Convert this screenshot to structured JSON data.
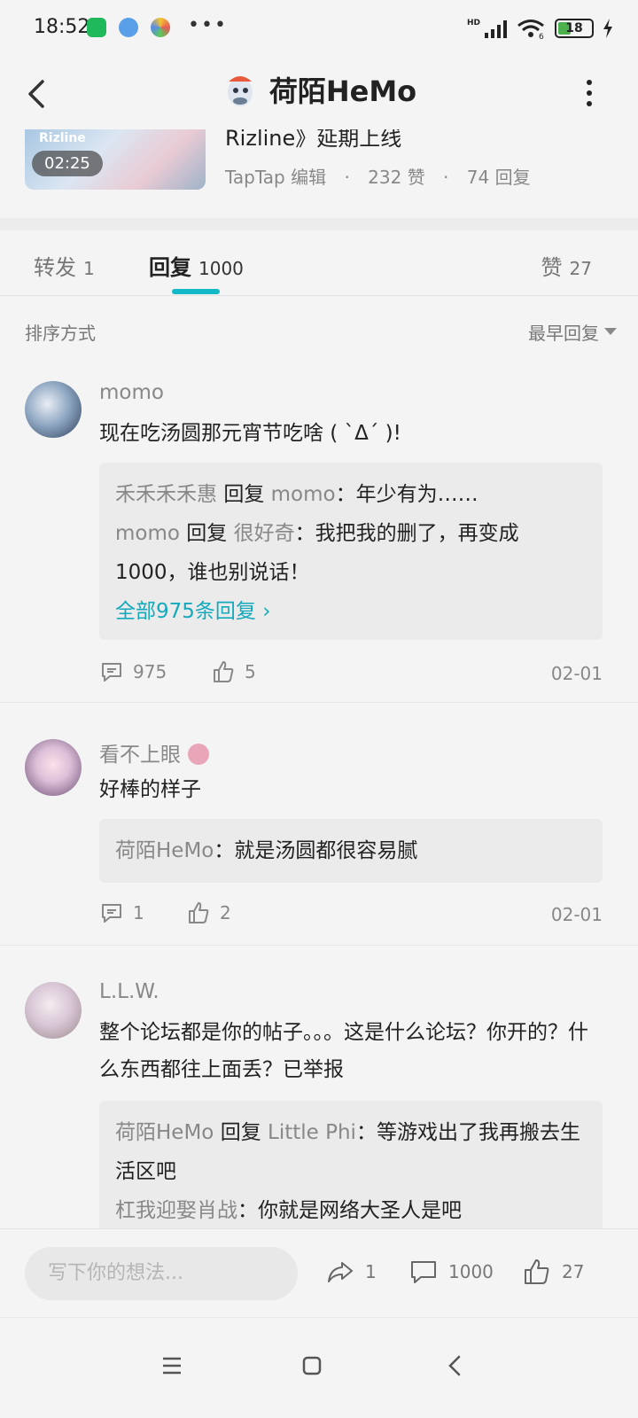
{
  "status_bar": {
    "time": "18:52",
    "battery": "18",
    "network": "HD",
    "wifi_label": "6"
  },
  "header": {
    "title": "荷陌HeMo"
  },
  "article": {
    "title": "Rizline》延期上线",
    "thumb_logo": "Rizline",
    "duration": "02:25",
    "source": "TapTap 编辑",
    "likes": "232 赞",
    "replies": "74 回复"
  },
  "tabs": [
    {
      "label": "转发",
      "count": "1"
    },
    {
      "label": "回复",
      "count": "1000"
    },
    {
      "label": "赞",
      "count": "27"
    }
  ],
  "sort": {
    "label": "排序方式",
    "value": "最早回复"
  },
  "comments": [
    {
      "user": "momo",
      "text": "现在吃汤圆那元宵节吃啥 ( `Δ´ )!",
      "replies": [
        {
          "from": "禾禾禾禾惠",
          "verb": "回复",
          "to": "momo",
          "text": "：年少有为……"
        },
        {
          "from": "momo",
          "verb": "回复",
          "to": "很好奇",
          "text": "：我把我的删了，再变成1000，谁也别说话！"
        }
      ],
      "more_link": "全部975条回复",
      "reply_count": "975",
      "like_count": "5",
      "date": "02-01"
    },
    {
      "user": "看不上眼",
      "text": "好棒的样子",
      "replies": [
        {
          "from": "荷陌HeMo",
          "text": "：就是汤圆都很容易腻"
        }
      ],
      "reply_count": "1",
      "like_count": "2",
      "date": "02-01"
    },
    {
      "user": "L.L.W.",
      "text": "整个论坛都是你的帖子。。。这是什么论坛？你开的？什么东西都往上面丢？已举报",
      "replies": [
        {
          "from": "荷陌HeMo",
          "verb": "回复",
          "to": "Little Phi",
          "text": "：等游戏出了我再搬去生活区吧"
        },
        {
          "from": "杠我迎娶肖战",
          "text": "：你就是网络大圣人是吧"
        }
      ]
    }
  ],
  "compose": {
    "placeholder": "写下你的想法...",
    "share_count": "1",
    "comment_count": "1000",
    "like_count": "27"
  },
  "colors": {
    "accent": "#14b9c8",
    "link": "#14a9bd"
  }
}
